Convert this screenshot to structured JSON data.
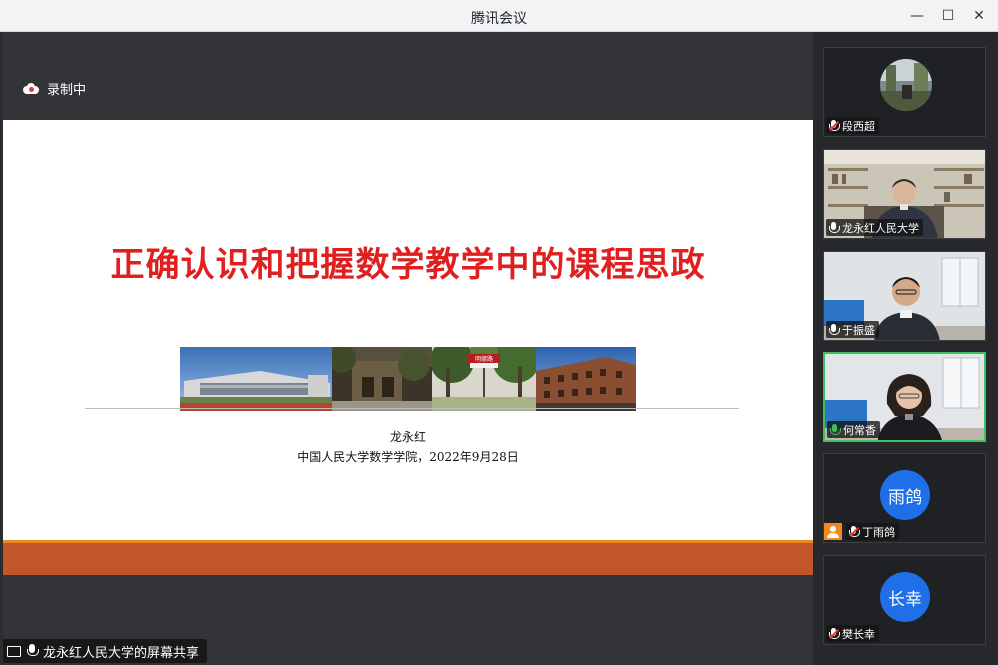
{
  "window": {
    "title": "腾讯会议",
    "minimize_glyph": "—",
    "maximize_glyph": "☐",
    "close_glyph": "✕"
  },
  "recording": {
    "label": "录制中",
    "icon": "cloud-record-icon"
  },
  "slide": {
    "title": "正确认识和把握数学教学中的课程思政",
    "author": "龙永红",
    "affiliation": "中国人民大学数学学院，2022年9月28日",
    "sign_text": "明德路"
  },
  "share_status": {
    "label": "龙永红人民大学的屏幕共享"
  },
  "participants": [
    {
      "name": "段西超",
      "mic": "muted",
      "video": "avatar-photo"
    },
    {
      "name": "龙永红人民大学",
      "mic": "on",
      "video": "camera"
    },
    {
      "name": "于振盛",
      "mic": "on",
      "video": "camera"
    },
    {
      "name": "何常香",
      "mic": "speaking",
      "video": "camera"
    },
    {
      "name": "丁雨鸽",
      "mic": "muted",
      "video": "initials",
      "initials": "雨鸽",
      "host": true
    },
    {
      "name": "樊长幸",
      "mic": "muted",
      "video": "initials",
      "initials": "长幸"
    }
  ],
  "colors": {
    "title_red": "#e02020",
    "orange_bar": "#c0562a",
    "speaking_green": "#3cc05c",
    "avatar_blue": "#1e6fe8"
  }
}
